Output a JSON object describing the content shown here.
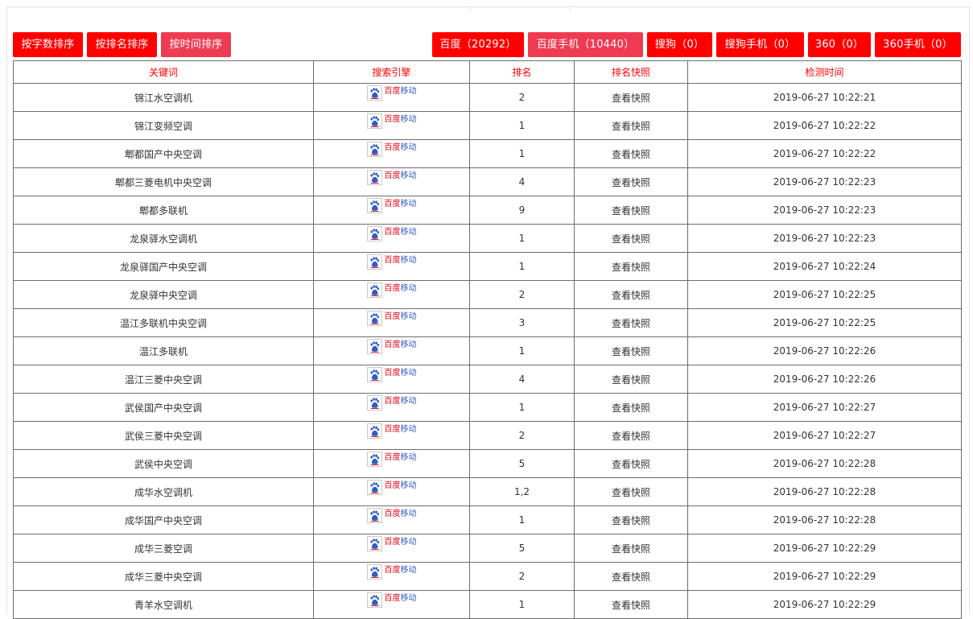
{
  "sort_buttons": [
    {
      "label": "按字数排序"
    },
    {
      "label": "按排名排序"
    },
    {
      "label": "按时间排序"
    }
  ],
  "engine_tabs": [
    {
      "label": "百度（20292）"
    },
    {
      "label": "百度手机（10440）"
    },
    {
      "label": "搜狗（0）"
    },
    {
      "label": "搜狗手机（0）"
    },
    {
      "label": "360（0）"
    },
    {
      "label": "360手机（0）"
    }
  ],
  "table": {
    "headers": [
      "关键词",
      "搜索引擎",
      "排名",
      "排名快照",
      "检测时间"
    ],
    "engine_label": {
      "part1": "百度",
      "part2": "移动"
    },
    "snapshot_label": "查看快照",
    "rows": [
      {
        "keyword": "锦江水空调机",
        "rank": "2",
        "time": "2019-06-27 10:22:21"
      },
      {
        "keyword": "锦江变频空调",
        "rank": "1",
        "time": "2019-06-27 10:22:22"
      },
      {
        "keyword": "郫都国产中央空调",
        "rank": "1",
        "time": "2019-06-27 10:22:22"
      },
      {
        "keyword": "郫都三菱电机中央空调",
        "rank": "4",
        "time": "2019-06-27 10:22:23"
      },
      {
        "keyword": "郫都多联机",
        "rank": "9",
        "time": "2019-06-27 10:22:23"
      },
      {
        "keyword": "龙泉驿水空调机",
        "rank": "1",
        "time": "2019-06-27 10:22:23"
      },
      {
        "keyword": "龙泉驿国产中央空调",
        "rank": "1",
        "time": "2019-06-27 10:22:24"
      },
      {
        "keyword": "龙泉驿中央空调",
        "rank": "2",
        "time": "2019-06-27 10:22:25"
      },
      {
        "keyword": "温江多联机中央空调",
        "rank": "3",
        "time": "2019-06-27 10:22:25"
      },
      {
        "keyword": "温江多联机",
        "rank": "1",
        "time": "2019-06-27 10:22:26"
      },
      {
        "keyword": "温江三菱中央空调",
        "rank": "4",
        "time": "2019-06-27 10:22:26"
      },
      {
        "keyword": "武侯国产中央空调",
        "rank": "1",
        "time": "2019-06-27 10:22:27"
      },
      {
        "keyword": "武侯三菱中央空调",
        "rank": "2",
        "time": "2019-06-27 10:22:27"
      },
      {
        "keyword": "武侯中央空调",
        "rank": "5",
        "time": "2019-06-27 10:22:28"
      },
      {
        "keyword": "成华水空调机",
        "rank": "1,2",
        "time": "2019-06-27 10:22:28"
      },
      {
        "keyword": "成华国产中央空调",
        "rank": "1",
        "time": "2019-06-27 10:22:28"
      },
      {
        "keyword": "成华三菱空调",
        "rank": "5",
        "time": "2019-06-27 10:22:29"
      },
      {
        "keyword": "成华三菱中央空调",
        "rank": "2",
        "time": "2019-06-27 10:22:29"
      },
      {
        "keyword": "青羊水空调机",
        "rank": "1",
        "time": "2019-06-27 10:22:29"
      }
    ]
  },
  "colors": {
    "button_red": "#ff0000",
    "button_active": "#ef3b52",
    "header_text": "#ff0000",
    "snapshot_link": "#3a73b5",
    "border": "#6d6d6d",
    "baidu_red": "#e60012",
    "baidu_blue": "#2f5cc4"
  },
  "icons": {
    "engine": "baidu-paw-icon"
  }
}
